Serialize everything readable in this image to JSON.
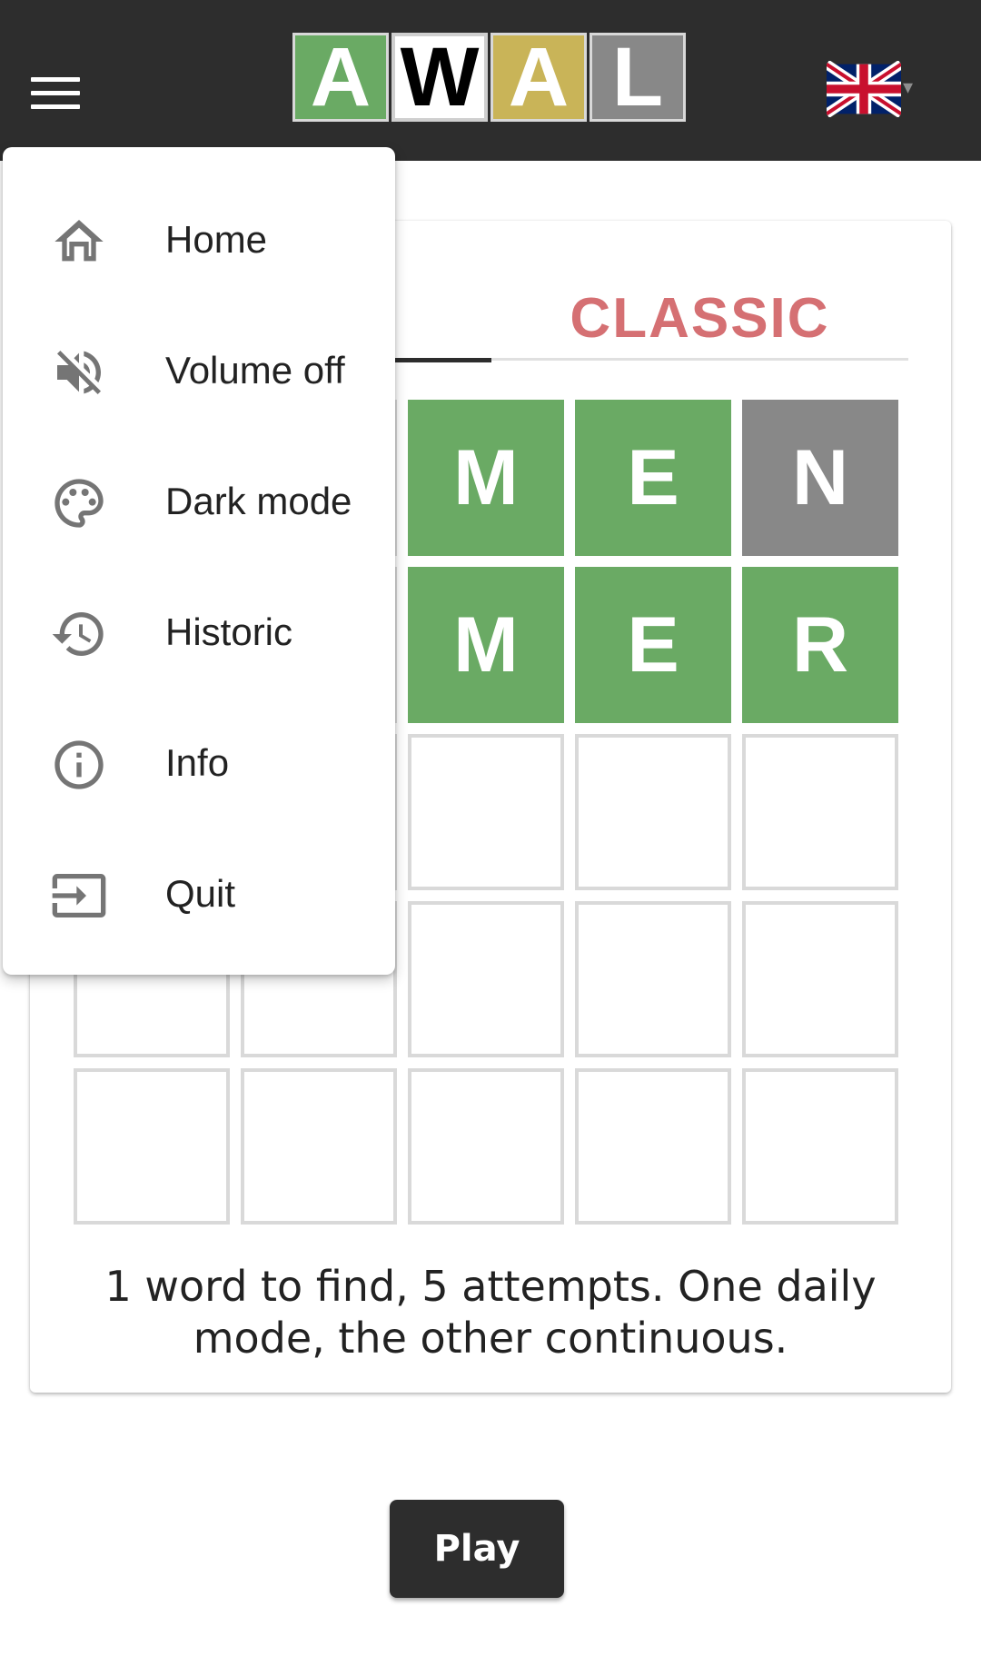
{
  "header": {
    "logo_letters": [
      {
        "letter": "A",
        "color": "#6aaa64"
      },
      {
        "letter": "W",
        "color": "#ffffff"
      },
      {
        "letter": "A",
        "color": "#c9b458"
      },
      {
        "letter": "L",
        "color": "#888888"
      }
    ],
    "language_icon": "uk-flag-icon",
    "menu_icon": "hamburger-menu-icon"
  },
  "menu": {
    "items": [
      {
        "label": "Home",
        "icon": "home-icon"
      },
      {
        "label": "Volume off",
        "icon": "volume-off-icon"
      },
      {
        "label": "Dark mode",
        "icon": "palette-icon"
      },
      {
        "label": "Historic",
        "icon": "history-icon"
      },
      {
        "label": "Info",
        "icon": "info-icon"
      },
      {
        "label": "Quit",
        "icon": "exit-icon"
      }
    ]
  },
  "card": {
    "tabs": [
      {
        "label": "",
        "active": true
      },
      {
        "label": "CLASSIC",
        "active": false
      }
    ],
    "grid": {
      "rows": [
        [
          {
            "letter": "",
            "state": "hidden"
          },
          {
            "letter": "",
            "state": "hidden"
          },
          {
            "letter": "M",
            "state": "correct"
          },
          {
            "letter": "E",
            "state": "correct"
          },
          {
            "letter": "N",
            "state": "absent"
          }
        ],
        [
          {
            "letter": "",
            "state": "hidden"
          },
          {
            "letter": "",
            "state": "hidden"
          },
          {
            "letter": "M",
            "state": "correct"
          },
          {
            "letter": "E",
            "state": "correct"
          },
          {
            "letter": "R",
            "state": "correct"
          }
        ],
        [
          {
            "letter": "",
            "state": "empty"
          },
          {
            "letter": "",
            "state": "empty"
          },
          {
            "letter": "",
            "state": "empty"
          },
          {
            "letter": "",
            "state": "empty"
          },
          {
            "letter": "",
            "state": "empty"
          }
        ],
        [
          {
            "letter": "",
            "state": "empty"
          },
          {
            "letter": "",
            "state": "empty"
          },
          {
            "letter": "",
            "state": "empty"
          },
          {
            "letter": "",
            "state": "empty"
          },
          {
            "letter": "",
            "state": "empty"
          }
        ],
        [
          {
            "letter": "",
            "state": "empty"
          },
          {
            "letter": "",
            "state": "empty"
          },
          {
            "letter": "",
            "state": "empty"
          },
          {
            "letter": "",
            "state": "empty"
          },
          {
            "letter": "",
            "state": "empty"
          }
        ]
      ]
    },
    "description_line1": "1 word to find, 5 attempts. One daily",
    "description_line2": "mode, the other continuous."
  },
  "play_label": "Play",
  "colors": {
    "header_bg": "#2d2d2d",
    "correct": "#6aaa64",
    "present": "#c9b458",
    "absent": "#888888",
    "classic_tab": "#d57073"
  }
}
